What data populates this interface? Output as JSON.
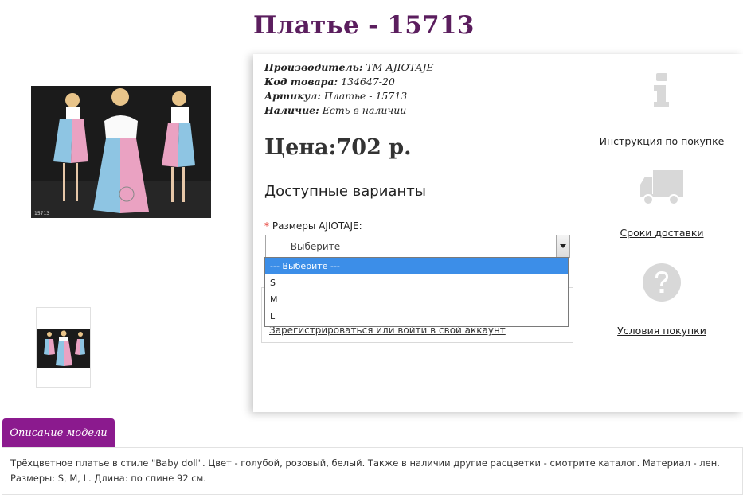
{
  "product": {
    "title": "Платье - 15713",
    "photo_code": "15713"
  },
  "info": {
    "manufacturer_label": "Производитель:",
    "manufacturer_value": "ТМ AJIOTAJE",
    "code_label": "Код товара:",
    "code_value": "134647-20",
    "article_label": "Артикул:",
    "article_value": "Платье - 15713",
    "availability_label": "Наличие:",
    "availability_value": "Есть в наличии"
  },
  "price": "Цена:702 р.",
  "variants": {
    "title": "Доступные варианты",
    "required_mark": "*",
    "size_label": "Размеры AJIOTAJE:",
    "selected": "--- Выберите ---",
    "options": [
      "--- Выберите ---",
      "S",
      "M",
      "L"
    ]
  },
  "login": {
    "link": "Зарегистрироваться или войти в свой аккаунт"
  },
  "side": {
    "instruction_link": "Инструкция по покупке",
    "delivery_link": "Сроки доставки",
    "conditions_link": "Условия покупки"
  },
  "description": {
    "tab_label": "Описание модели",
    "text": "Трёхцветное платье в стиле \"Baby doll\". Цвет - голубой, розовый, белый. Также в наличии другие расцветки - смотрите каталог. Материал - лен. Размеры: S, M, L. Длина: по спине 92 см."
  },
  "colors": {
    "title": "#5b1e5e",
    "tab": "#8b1a8e",
    "dropdown_highlight": "#3c8ee8",
    "icon_gray": "#d8d8d8"
  }
}
